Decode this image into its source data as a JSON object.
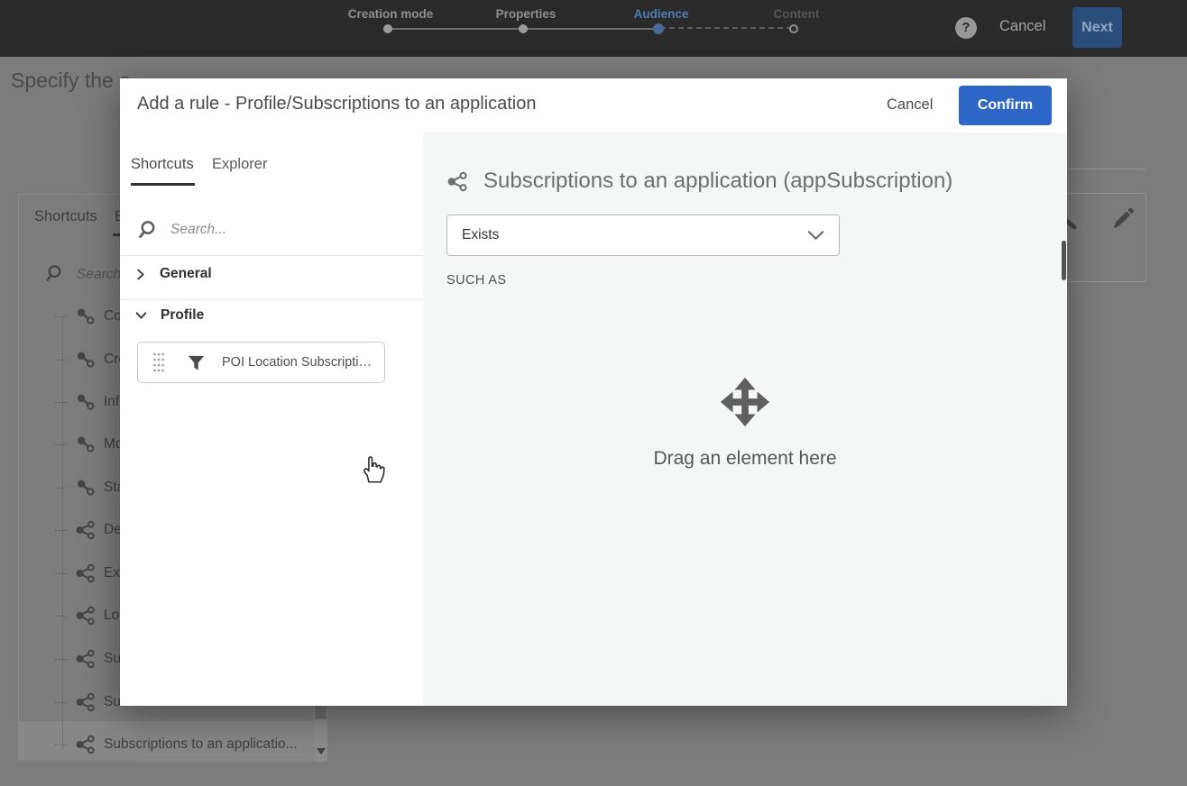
{
  "topbar": {
    "steps": [
      {
        "label": "Creation mode",
        "state": "done"
      },
      {
        "label": "Properties",
        "state": "done"
      },
      {
        "label": "Audience",
        "state": "active"
      },
      {
        "label": "Content",
        "state": "upcoming"
      }
    ],
    "help_label": "?",
    "cancel_label": "Cancel",
    "next_label": "Next"
  },
  "background": {
    "heading": "Specify the e",
    "panel": {
      "tabs": [
        "Shortcuts",
        "E"
      ],
      "search_placeholder": "Search...",
      "items": [
        {
          "label": "Countr",
          "icon": "link"
        },
        {
          "label": "Create",
          "icon": "link"
        },
        {
          "label": "Info ab",
          "icon": "link"
        },
        {
          "label": "Modifi",
          "icon": "link"
        },
        {
          "label": "State (",
          "icon": "link"
        },
        {
          "label": "Deliver",
          "icon": "share"
        },
        {
          "label": "Exclusi",
          "icon": "share"
        },
        {
          "label": "Locatio",
          "icon": "share"
        },
        {
          "label": "Subscr",
          "icon": "share"
        },
        {
          "label": "Subscr",
          "icon": "share"
        },
        {
          "label": "Subscriptions to an applicatio...",
          "icon": "share",
          "selected": true
        }
      ]
    }
  },
  "modal": {
    "title": "Add a rule - Profile/Subscriptions to an application",
    "cancel_label": "Cancel",
    "confirm_label": "Confirm",
    "left": {
      "tabs": [
        {
          "label": "Shortcuts",
          "active": true
        },
        {
          "label": "Explorer",
          "active": false
        }
      ],
      "search_placeholder": "Search...",
      "sections": [
        {
          "label": "General",
          "expanded": false
        },
        {
          "label": "Profile",
          "expanded": true
        }
      ],
      "item_label": "POI Location Subscripti…"
    },
    "right": {
      "title": "Subscriptions to an application (appSubscription)",
      "operator_value": "Exists",
      "such_as_label": "SUCH AS",
      "drop_hint": "Drag an element here"
    }
  },
  "colors": {
    "accent_blue": "#2d66c6",
    "step_active_blue": "#4f7db3",
    "topbar_bg": "#2a2a2b",
    "overlay_gray": "#7c7c7c",
    "right_pane_bg": "#f5f6f6"
  }
}
